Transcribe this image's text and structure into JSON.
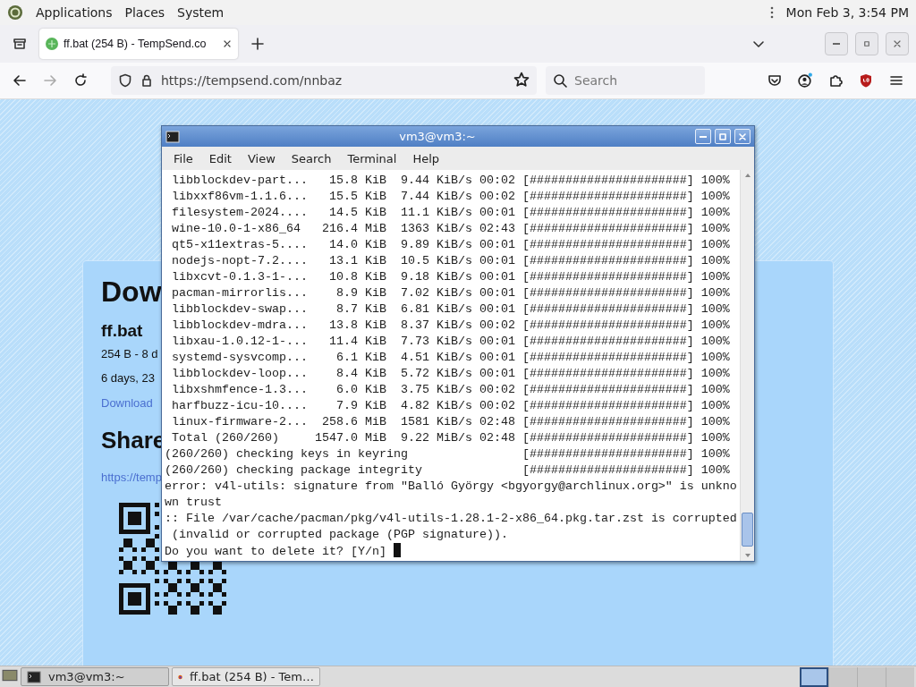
{
  "top_panel": {
    "menus": [
      "Applications",
      "Places",
      "System"
    ],
    "clock": "Mon Feb 3, 3:54 PM"
  },
  "browser": {
    "tabs": [
      {
        "title": "ff.bat (254 B) - TempSend.co",
        "selected": true
      }
    ],
    "url": "https://tempsend.com/nnbaz",
    "search": {
      "placeholder": "Search"
    }
  },
  "page": {
    "heading": "Dow",
    "file_name": "ff.bat",
    "meta": "254 B - 8 d",
    "expiry": "6 days, 23",
    "download_link": "Download",
    "share_heading": "Share",
    "share_link": "https://temp"
  },
  "terminal": {
    "title": "vm3@vm3:~",
    "menus": [
      "File",
      "Edit",
      "View",
      "Search",
      "Terminal",
      "Help"
    ],
    "lines": [
      " libblockdev-part...   15.8 KiB  9.44 KiB/s 00:02 [######################] 100%",
      " libxxf86vm-1.1.6...   15.5 KiB  7.44 KiB/s 00:02 [######################] 100%",
      " filesystem-2024....   14.5 KiB  11.1 KiB/s 00:01 [######################] 100%",
      " wine-10.0-1-x86_64   216.4 MiB  1363 KiB/s 02:43 [######################] 100%",
      " qt5-x11extras-5....   14.0 KiB  9.89 KiB/s 00:01 [######################] 100%",
      " nodejs-nopt-7.2....   13.1 KiB  10.5 KiB/s 00:01 [######################] 100%",
      " libxcvt-0.1.3-1-...   10.8 KiB  9.18 KiB/s 00:01 [######################] 100%",
      " pacman-mirrorlis...    8.9 KiB  7.02 KiB/s 00:01 [######################] 100%",
      " libblockdev-swap...    8.7 KiB  6.81 KiB/s 00:01 [######################] 100%",
      " libblockdev-mdra...   13.8 KiB  8.37 KiB/s 00:02 [######################] 100%",
      " libxau-1.0.12-1-...   11.4 KiB  7.73 KiB/s 00:01 [######################] 100%",
      " systemd-sysvcomp...    6.1 KiB  4.51 KiB/s 00:01 [######################] 100%",
      " libblockdev-loop...    8.4 KiB  5.72 KiB/s 00:01 [######################] 100%",
      " libxshmfence-1.3...    6.0 KiB  3.75 KiB/s 00:02 [######################] 100%",
      " harfbuzz-icu-10....    7.9 KiB  4.82 KiB/s 00:02 [######################] 100%",
      " linux-firmware-2...  258.6 MiB  1581 KiB/s 02:48 [######################] 100%",
      " Total (260/260)     1547.0 MiB  9.22 MiB/s 02:48 [######################] 100%",
      "(260/260) checking keys in keyring                [######################] 100%",
      "(260/260) checking package integrity              [######################] 100%",
      "error: v4l-utils: signature from \"Balló György <bgyorgy@archlinux.org>\" is unkno",
      "wn trust",
      ":: File /var/cache/pacman/pkg/v4l-utils-1.28.1-2-x86_64.pkg.tar.zst is corrupted",
      " (invalid or corrupted package (PGP signature))."
    ],
    "prompt": "Do you want to delete it? [Y/n]"
  },
  "taskbar": {
    "tasks": [
      {
        "kind": "terminal",
        "label": "vm3@vm3:~",
        "selected": true
      },
      {
        "kind": "browser",
        "label": "ff.bat (254 B) - Tem…",
        "selected": false
      }
    ],
    "workspaces": [
      {
        "selected": true
      },
      {
        "selected": false
      },
      {
        "selected": false
      },
      {
        "selected": false
      }
    ]
  }
}
